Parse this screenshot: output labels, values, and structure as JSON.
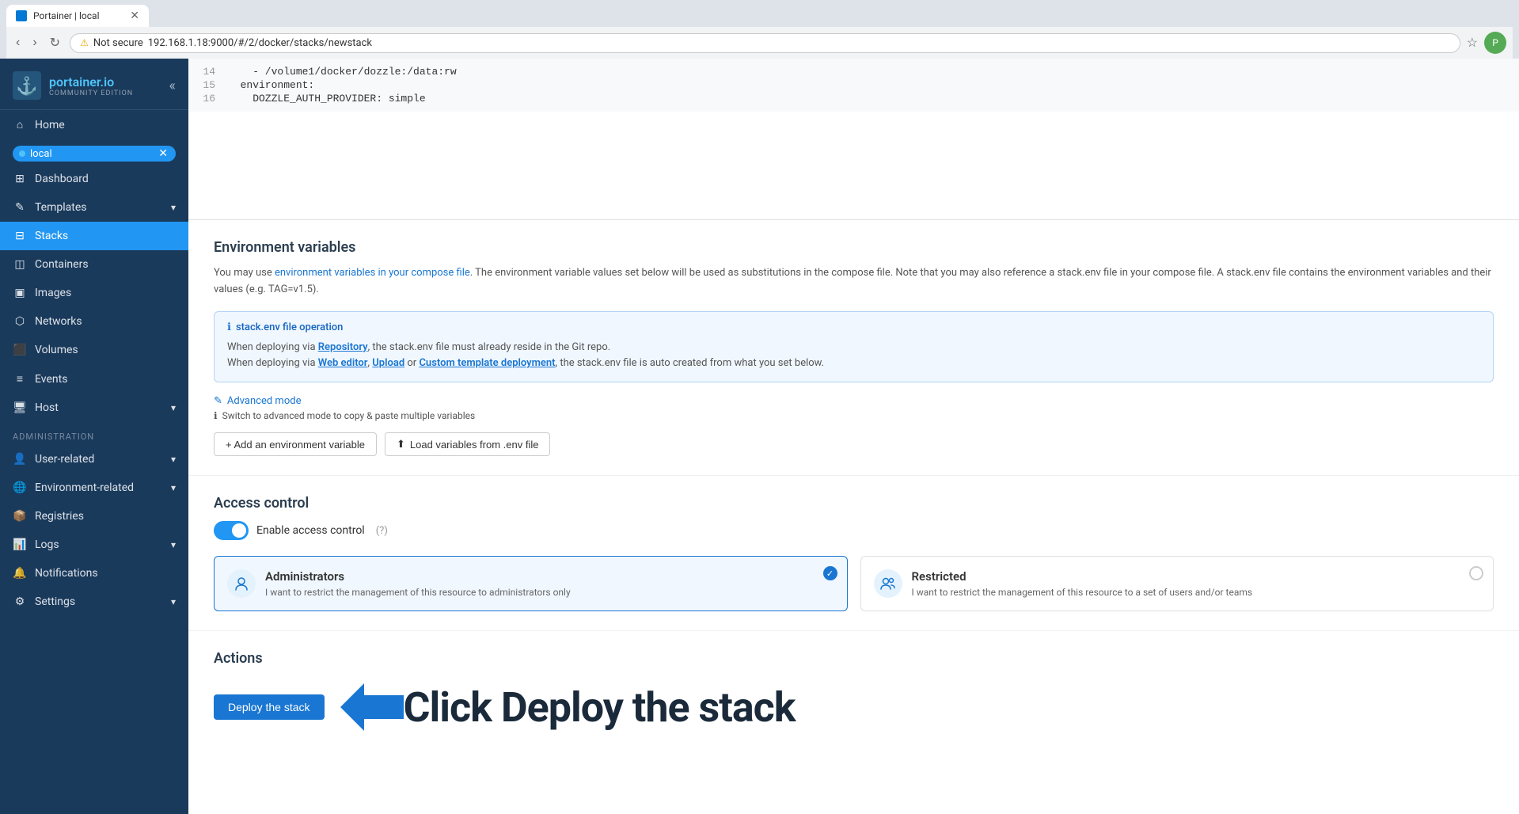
{
  "browser": {
    "tab_title": "Portainer | local",
    "url": "192.168.1.18:9000/#/2/docker/stacks/newstack",
    "security_label": "Not secure"
  },
  "sidebar": {
    "logo_main": "portainer.io",
    "logo_sub": "COMMUNITY EDITION",
    "collapse_icon": "«",
    "env_name": "local",
    "nav_items": [
      {
        "label": "Home",
        "icon": "⌂"
      },
      {
        "label": "Dashboard",
        "icon": "⊞"
      },
      {
        "label": "Templates",
        "icon": "✎",
        "has_chevron": true
      },
      {
        "label": "Stacks",
        "icon": "⊟",
        "active": true
      },
      {
        "label": "Containers",
        "icon": "⚙"
      },
      {
        "label": "Images",
        "icon": "🖼"
      },
      {
        "label": "Networks",
        "icon": "⬡"
      },
      {
        "label": "Volumes",
        "icon": "💾"
      },
      {
        "label": "Events",
        "icon": "📋"
      },
      {
        "label": "Host",
        "icon": "🖥",
        "has_chevron": true
      }
    ],
    "admin_label": "Administration",
    "admin_items": [
      {
        "label": "User-related",
        "icon": "👤",
        "has_chevron": true
      },
      {
        "label": "Environment-related",
        "icon": "🌐",
        "has_chevron": true
      },
      {
        "label": "Registries",
        "icon": "📦"
      },
      {
        "label": "Logs",
        "icon": "📊",
        "has_chevron": true
      },
      {
        "label": "Notifications",
        "icon": "🔔"
      },
      {
        "label": "Settings",
        "icon": "⚙",
        "has_chevron": true
      }
    ]
  },
  "code": {
    "lines": [
      {
        "num": "14",
        "content": "    - /volume1/docker/dozzle:/data:rw"
      },
      {
        "num": "15",
        "content": "  environment:"
      },
      {
        "num": "16",
        "content": "    DOZZLE_AUTH_PROVIDER: simple"
      }
    ]
  },
  "env_vars": {
    "section_title": "Environment variables",
    "desc_text": "You may use ",
    "desc_link": "environment variables in your compose file",
    "desc_rest": ". The environment variable values set below will be used as substitutions in the compose file. Note that you may also reference a stack.env file in your compose file. A stack.env file contains the environment variables and their values (e.g. TAG=v1.5).",
    "info_title": "stack.env file operation",
    "info_line1_pre": "When deploying via ",
    "info_line1_link": "Repository",
    "info_line1_post": ", the stack.env file must already reside in the Git repo.",
    "info_line2_pre": "When deploying via ",
    "info_line2_link1": "Web editor",
    "info_line2_mid": ", ",
    "info_line2_link2": "Upload",
    "info_line2_mid2": " or ",
    "info_line2_link3": "Custom template deployment",
    "info_line2_post": ", the stack.env file is auto created from what you set below.",
    "advanced_mode_label": "Advanced mode",
    "advanced_mode_sub": "Switch to advanced mode to copy & paste multiple variables",
    "add_env_btn": "+ Add an environment variable",
    "load_env_btn": "Load variables from .env file"
  },
  "access_control": {
    "section_title": "Access control",
    "toggle_label": "Enable access control",
    "toggle_on": true,
    "administrators": {
      "title": "Administrators",
      "description": "I want to restrict the management of this resource to administrators only",
      "selected": true
    },
    "restricted": {
      "title": "Restricted",
      "description": "I want to restrict the management of this resource to a set of users and/or teams",
      "selected": false
    }
  },
  "actions": {
    "section_title": "Actions",
    "deploy_btn": "Deploy the stack",
    "annotation_text": "Click Deploy the stack"
  }
}
